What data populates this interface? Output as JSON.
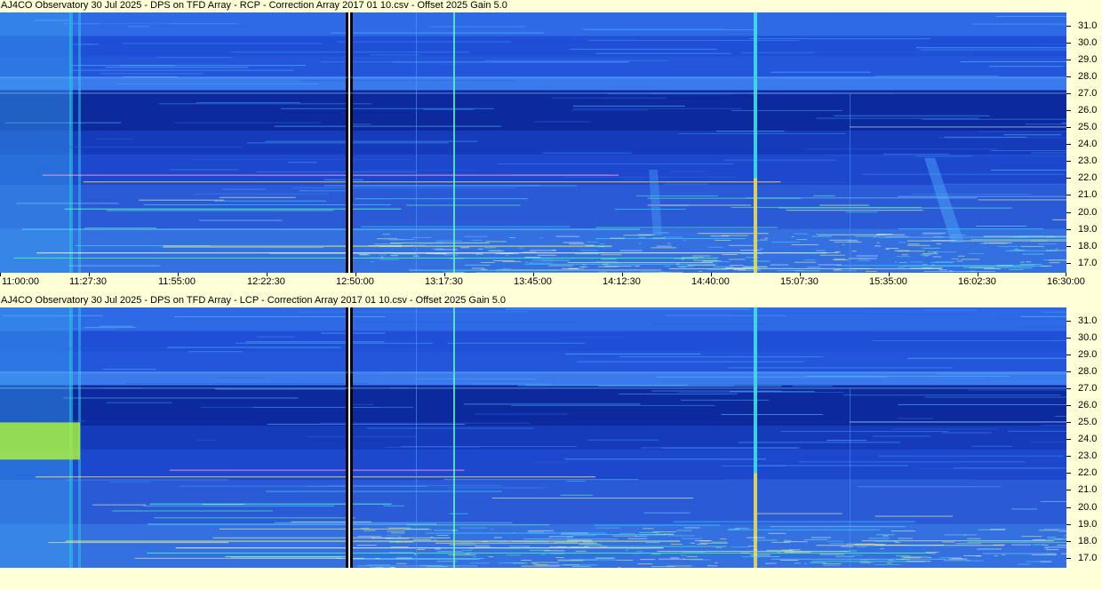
{
  "chart_data": [
    {
      "type": "heatmap",
      "title": "AJ4CO Observatory 30 Jul 2025  -  DPS on TFD Array  -  RCP  -  Correction Array 2017 01 10.csv  -  Offset 2025  Gain 5.0",
      "x_ticks": [
        "11:00:00",
        "11:27:30",
        "11:55:00",
        "12:22:30",
        "12:50:00",
        "13:17:30",
        "13:45:00",
        "14:12:30",
        "14:40:00",
        "15:07:30",
        "15:35:00",
        "16:02:30",
        "16:30:00"
      ],
      "y_ticks": [
        "31.0",
        "30.0",
        "29.0",
        "28.0",
        "27.0",
        "26.0",
        "25.0",
        "24.0",
        "23.0",
        "22.0",
        "21.0",
        "20.0",
        "19.0",
        "18.0",
        "17.0"
      ],
      "xlim": [
        "11:00:00",
        "16:30:00"
      ],
      "ylim": [
        16.4,
        31.8
      ]
    },
    {
      "type": "heatmap",
      "title": "AJ4CO Observatory 30 Jul 2025  -  DPS on TFD Array  -  LCP  -  Correction Array 2017 01 10.csv  -  Offset 2025  Gain 5.0",
      "x_ticks": [],
      "y_ticks": [
        "31.0",
        "30.0",
        "29.0",
        "28.0",
        "27.0",
        "26.0",
        "25.0",
        "24.0",
        "23.0",
        "22.0",
        "21.0",
        "20.0",
        "19.0",
        "18.0",
        "17.0"
      ],
      "xlim": [
        "11:00:00",
        "16:30:00"
      ],
      "ylim": [
        16.4,
        31.8
      ]
    }
  ],
  "colors": {
    "background": "#ffffd8",
    "spectrogram_base": "#1c46d8",
    "quiet_band": "#0a1f8a",
    "hot": "#ffff40",
    "warm": "#40ffb0"
  }
}
